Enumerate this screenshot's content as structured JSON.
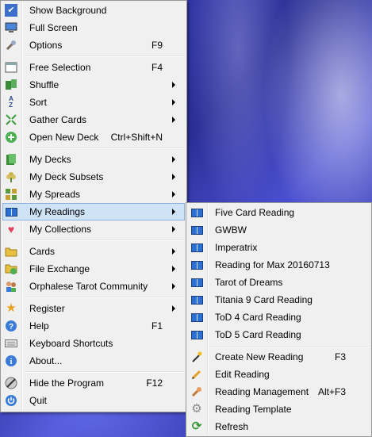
{
  "main_menu": {
    "items": [
      {
        "label": "Show Background",
        "shortcut": "",
        "icon": "check-icon"
      },
      {
        "label": "Full Screen",
        "shortcut": "",
        "icon": "monitor-icon"
      },
      {
        "label": "Options",
        "shortcut": "F9",
        "icon": "wrench-icon"
      },
      {
        "label": "Free Selection",
        "shortcut": "F4",
        "icon": "selection-icon"
      },
      {
        "label": "Shuffle",
        "shortcut": "",
        "icon": "shuffle-icon"
      },
      {
        "label": "Sort",
        "shortcut": "",
        "icon": "sort-az-icon"
      },
      {
        "label": "Gather Cards",
        "shortcut": "",
        "icon": "gather-icon"
      },
      {
        "label": "Open New Deck",
        "shortcut": "Ctrl+Shift+N",
        "icon": "plus-icon"
      },
      {
        "label": "My Decks",
        "shortcut": "",
        "icon": "deck-icon"
      },
      {
        "label": "My Deck Subsets",
        "shortcut": "",
        "icon": "flower-icon"
      },
      {
        "label": "My Spreads",
        "shortcut": "",
        "icon": "spread-icon"
      },
      {
        "label": "My Readings",
        "shortcut": "",
        "icon": "book-icon"
      },
      {
        "label": "My Collections",
        "shortcut": "",
        "icon": "heart-icon"
      },
      {
        "label": "Cards",
        "shortcut": "",
        "icon": "folder-icon"
      },
      {
        "label": "File Exchange",
        "shortcut": "",
        "icon": "exchange-icon"
      },
      {
        "label": "Orphalese Tarot Community",
        "shortcut": "",
        "icon": "community-icon"
      },
      {
        "label": "Register",
        "shortcut": "",
        "icon": "star-icon"
      },
      {
        "label": "Help",
        "shortcut": "F1",
        "icon": "help-icon"
      },
      {
        "label": "Keyboard Shortcuts",
        "shortcut": "",
        "icon": "keyboard-icon"
      },
      {
        "label": "About...",
        "shortcut": "",
        "icon": "info-icon"
      },
      {
        "label": "Hide the Program",
        "shortcut": "F12",
        "icon": "hide-icon"
      },
      {
        "label": "Quit",
        "shortcut": "",
        "icon": "power-icon"
      }
    ]
  },
  "readings_submenu": {
    "items": [
      {
        "label": "Five Card Reading",
        "shortcut": ""
      },
      {
        "label": "GWBW",
        "shortcut": ""
      },
      {
        "label": "Imperatrix",
        "shortcut": ""
      },
      {
        "label": "Reading for Max 20160713",
        "shortcut": ""
      },
      {
        "label": "Tarot of Dreams",
        "shortcut": ""
      },
      {
        "label": "Titania 9 Card Reading",
        "shortcut": ""
      },
      {
        "label": "ToD 4 Card Reading",
        "shortcut": ""
      },
      {
        "label": "ToD 5 Card Reading",
        "shortcut": ""
      },
      {
        "label": "Create New Reading",
        "shortcut": "F3"
      },
      {
        "label": "Edit Reading",
        "shortcut": ""
      },
      {
        "label": "Reading Management",
        "shortcut": "Alt+F3"
      },
      {
        "label": "Reading Template",
        "shortcut": ""
      },
      {
        "label": "Refresh",
        "shortcut": ""
      }
    ]
  },
  "colors": {
    "menu_background": "#f0f0f0",
    "highlight": "#cfe3f7",
    "desktop": "#2b2f9a"
  }
}
